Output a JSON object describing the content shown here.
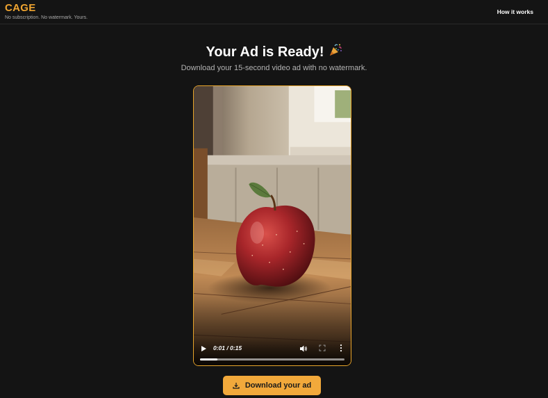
{
  "header": {
    "brand": "CAGE",
    "tagline": "No subscription. No watermark. Yours.",
    "nav_link": "How it works"
  },
  "main": {
    "title": "Your Ad is Ready!",
    "title_emoji_icon": "party-popper-icon",
    "subtitle": "Download your 15-second video ad with no watermark."
  },
  "video": {
    "scene_description_icon": "apple-on-wooden-floor-image",
    "time_display": "0:01 / 0:15",
    "progress_fraction": 0.12,
    "controls": [
      "play-icon",
      "volume-icon",
      "fullscreen-icon",
      "more-options-icon"
    ]
  },
  "download": {
    "label": "Download your ad",
    "icon": "download-icon"
  },
  "colors": {
    "accent": "#f0a530",
    "button_bg": "#f2a93b",
    "background": "#141414",
    "video_border": "#e9a52a"
  }
}
